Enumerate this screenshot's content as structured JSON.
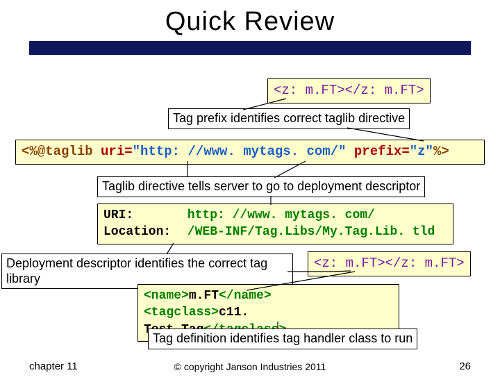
{
  "title": "Quick Review",
  "box1_code": "<z: m.FT></z: m.FT>",
  "label1": "Tag prefix identifies correct taglib directive",
  "box2": {
    "pre": "<%@taglib ",
    "uri_key": "uri=",
    "uri_val": "\"http: //www. mytags. com/\"",
    "sp": " ",
    "prefix_key": "prefix=",
    "prefix_val": "\"z\"",
    "suf": "%>"
  },
  "label2": "Taglib directive tells server to go to deployment descriptor",
  "box3": {
    "uri_lbl": "URI:",
    "uri_val": "http: //www. mytags. com/",
    "loc_lbl": "Location:",
    "loc_val": "/WEB-INF/Tag.Libs/My.Tag.Lib. tld"
  },
  "label3": "Deployment descriptor identifies the correct tag library",
  "box4_code": "<z: m.FT></z: m.FT>",
  "box5": {
    "name_open": "<name>",
    "name_txt": "m.FT",
    "name_close": "</name>",
    "tc_open": "<tagclass>",
    "tc_txt": "c11. Test.Tag",
    "tc_close": "</tagclass>"
  },
  "label4": "Tag definition identifies tag handler class to run",
  "footer": {
    "left": "chapter 11",
    "center": "© copyright Janson Industries 2011",
    "right": "26"
  }
}
